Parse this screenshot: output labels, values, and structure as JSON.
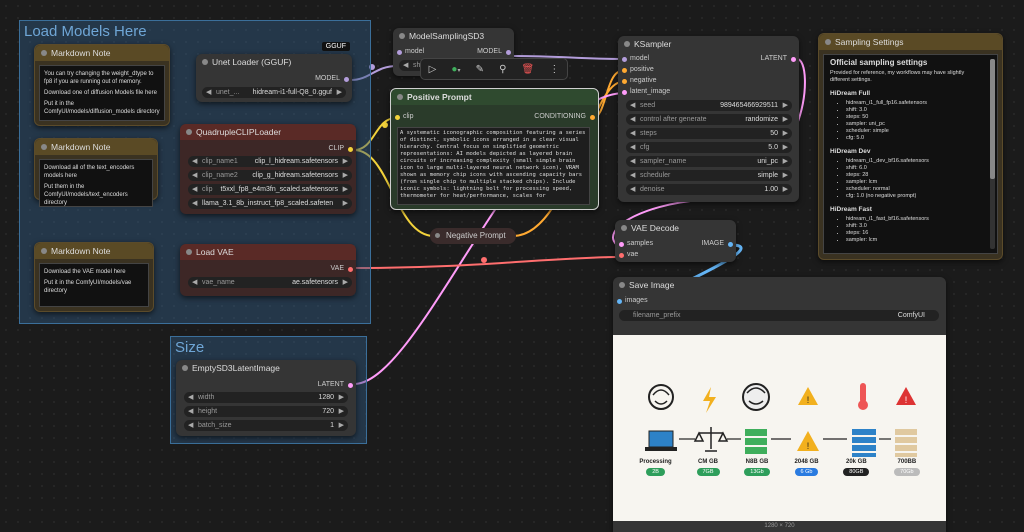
{
  "groups": {
    "load_models": "Load Models Here",
    "size": "Size"
  },
  "notes": [
    {
      "title": "Markdown Note",
      "lines": [
        "You can try changing the weight_dtype to fp8 if you are running out of memory.",
        "Download one of diffusion Models file here",
        "Put it in the ComfyUI/models/diffusion_models directory"
      ]
    },
    {
      "title": "Markdown Note",
      "lines": [
        "Download all of the text_encoders models here",
        "Put them in the ComfyUI/models/text_encoders directory"
      ]
    },
    {
      "title": "Markdown Note",
      "lines": [
        "Download the VAE model here",
        "Put it in the ComfyUI/models/vae directory"
      ]
    }
  ],
  "unet": {
    "title": "Unet Loader (GGUF)",
    "badge": "GGUF",
    "output": "MODEL",
    "widget_label": "unet_...",
    "widget_value": "hidream-i1-full-Q8_0.gguf"
  },
  "clip_loader": {
    "title": "QuadrupleCLIPLoader",
    "output": "CLIP",
    "widgets": [
      {
        "label": "clip_name1",
        "value": "clip_l_hidream.safetensors"
      },
      {
        "label": "clip_name2",
        "value": "clip_g_hidream.safetensors"
      },
      {
        "label": "clip",
        "value": "t5xxl_fp8_e4m3fn_scaled.safetensors"
      },
      {
        "label": "",
        "value": "llama_3.1_8b_instruct_fp8_scaled.safeten"
      }
    ]
  },
  "vae_loader": {
    "title": "Load VAE",
    "output": "VAE",
    "widget_label": "vae_name",
    "widget_value": "ae.safetensors"
  },
  "model_sampling": {
    "title": "ModelSamplingSD3",
    "input": "model",
    "output": "MODEL",
    "widget_label": "sh"
  },
  "positive": {
    "title": "Positive Prompt",
    "input": "clip",
    "output": "CONDITIONING",
    "text": "A systematic iconographic composition featuring a series of distinct, symbolic icons arranged in a clear visual hierarchy. Central focus on simplified geometric representations: AI models depicted as layered brain circuits of increasing complexity (small simple brain icon to large multi-layered neural network icon), VRAM shown as memory chip icons with ascending capacity bars (from single chip to multiple stacked chips). Include iconic symbols: lightning bolt for processing speed, thermometer for heat/performance, scales for"
  },
  "negative": {
    "title": "Negative Prompt"
  },
  "empty_latent": {
    "title": "EmptySD3LatentImage",
    "output": "LATENT",
    "widgets": [
      {
        "label": "width",
        "value": "1280"
      },
      {
        "label": "height",
        "value": "720"
      },
      {
        "label": "batch_size",
        "value": "1"
      }
    ]
  },
  "ksampler": {
    "title": "KSampler",
    "inputs": [
      "model",
      "positive",
      "negative",
      "latent_image"
    ],
    "output": "LATENT",
    "widgets": [
      {
        "label": "seed",
        "value": "989465466929511"
      },
      {
        "label": "control after generate",
        "value": "randomize"
      },
      {
        "label": "steps",
        "value": "50"
      },
      {
        "label": "cfg",
        "value": "5.0"
      },
      {
        "label": "sampler_name",
        "value": "uni_pc"
      },
      {
        "label": "scheduler",
        "value": "simple"
      },
      {
        "label": "denoise",
        "value": "1.00"
      }
    ]
  },
  "vae_decode": {
    "title": "VAE Decode",
    "inputs": [
      "samples",
      "vae"
    ],
    "output": "IMAGE"
  },
  "save_image": {
    "title": "Save Image",
    "input": "images",
    "widget_label": "filename_prefix",
    "widget_value": "ComfyUI",
    "caption": "1280 × 720"
  },
  "infographic": {
    "items": [
      {
        "label": "Processing",
        "pill": "2B",
        "pill_color": "#2e9e5b"
      },
      {
        "label": "CM GB",
        "pill": "7GB",
        "pill_color": "#2e9e5b"
      },
      {
        "label": "N8B GB",
        "pill": "13Gb",
        "pill_color": "#2e9e5b"
      },
      {
        "label": "2048 GB",
        "pill": "6 Gb",
        "pill_color": "#2a7be0"
      },
      {
        "label": "20k GB",
        "pill": "80GB",
        "pill_color": "#222222"
      },
      {
        "label": "700BB",
        "pill": "70Gb",
        "pill_color": "#bbbbbb"
      }
    ]
  },
  "settings": {
    "title": "Sampling Settings",
    "heading": "Official sampling settings",
    "intro": "Provided for reference, my workflows may have slightly different settings.",
    "sections": [
      {
        "name": "HiDream Full",
        "items": [
          "hidream_i1_full_fp16.safetensors",
          "shift: 3.0",
          "steps: 50",
          "sampler: uni_pc",
          "scheduler: simple",
          "cfg: 5.0"
        ]
      },
      {
        "name": "HiDream Dev",
        "items": [
          "hidream_i1_dev_bf16.safetensors",
          "shift: 6.0",
          "steps: 28",
          "sampler: lcm",
          "scheduler: normal",
          "cfg: 1.0 (no negative prompt)"
        ]
      },
      {
        "name": "HiDream Fast",
        "items": [
          "hidream_i1_fast_bf16.safetensors",
          "shift: 3.0",
          "steps: 16",
          "sampler: lcm"
        ]
      }
    ]
  },
  "colors": {
    "clip": "#f2d23b",
    "model": "#b39ddb",
    "latent": "#ff9cf9",
    "vae": "#ff6e6e",
    "image": "#64b5f6",
    "conditioning": "#ffa931"
  }
}
